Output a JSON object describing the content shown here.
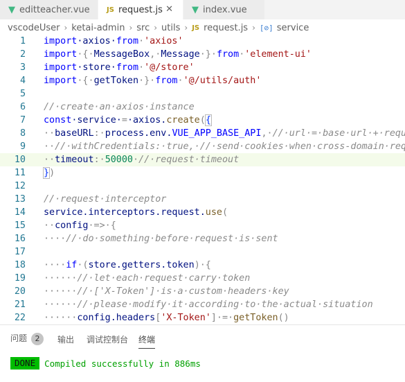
{
  "tabs": [
    {
      "label": "editteacher.vue",
      "icon": "vue-icon",
      "active": false
    },
    {
      "label": "request.js",
      "icon": "js-icon",
      "icon_text": "JS",
      "active": true,
      "close": "✕"
    },
    {
      "label": "index.vue",
      "icon": "vue-icon",
      "active": false
    }
  ],
  "breadcrumb": {
    "items": [
      "vscodeUser",
      "ketai-admin",
      "src",
      "utils"
    ],
    "file_icon": "JS",
    "file": "request.js",
    "symbol_icon": "[⊘]",
    "symbol": "service"
  },
  "editor": {
    "highlighted_line": 10,
    "lines": [
      {
        "n": "1",
        "tokens": [
          [
            "import",
            "kw"
          ],
          [
            "·axios·",
            "id"
          ],
          [
            "from",
            "kw"
          ],
          [
            "·",
            "ws"
          ],
          [
            "'axios'",
            "str"
          ]
        ]
      },
      {
        "n": "2",
        "tokens": [
          [
            "import",
            "kw"
          ],
          [
            "·{·",
            "ws"
          ],
          [
            "MessageBox",
            "id"
          ],
          [
            ",·",
            "ws"
          ],
          [
            "Message",
            "id"
          ],
          [
            "·}·",
            "ws"
          ],
          [
            "from",
            "kw"
          ],
          [
            "·",
            "ws"
          ],
          [
            "'element-ui'",
            "str"
          ]
        ]
      },
      {
        "n": "3",
        "tokens": [
          [
            "import",
            "kw"
          ],
          [
            "·store·",
            "id"
          ],
          [
            "from",
            "kw"
          ],
          [
            "·",
            "ws"
          ],
          [
            "'@/store'",
            "str"
          ]
        ]
      },
      {
        "n": "4",
        "tokens": [
          [
            "import",
            "kw"
          ],
          [
            "·{·",
            "ws"
          ],
          [
            "getToken",
            "id"
          ],
          [
            "·}·",
            "ws"
          ],
          [
            "from",
            "kw"
          ],
          [
            "·",
            "ws"
          ],
          [
            "'@/utils/auth'",
            "str"
          ]
        ]
      },
      {
        "n": "5",
        "tokens": []
      },
      {
        "n": "6",
        "tokens": [
          [
            "//·create·an·axios·instance",
            "cm"
          ]
        ]
      },
      {
        "n": "7",
        "tokens": [
          [
            "const",
            "kw"
          ],
          [
            "·service·",
            "id"
          ],
          [
            "=",
            "ws"
          ],
          [
            "·axios.",
            "id"
          ],
          [
            "create",
            "fn"
          ],
          [
            "(",
            "ws"
          ],
          [
            "{",
            "br"
          ]
        ]
      },
      {
        "n": "8",
        "tokens": [
          [
            "··",
            "ws"
          ],
          [
            "baseURL",
            "id"
          ],
          [
            ":·",
            "ws"
          ],
          [
            "process.env.",
            "id"
          ],
          [
            "VUE_APP_BASE_API",
            "kw"
          ],
          [
            ",·",
            "ws"
          ],
          [
            "//·url·=·base·url·+·request·url",
            "cm"
          ]
        ]
      },
      {
        "n": "9",
        "tokens": [
          [
            "··",
            "ws"
          ],
          [
            "//·withCredentials:·true,·//·send·cookies·when·cross-domain·requests",
            "cm"
          ]
        ]
      },
      {
        "n": "10",
        "tokens": [
          [
            "··",
            "ws"
          ],
          [
            "timeout",
            "id"
          ],
          [
            ":·",
            "ws"
          ],
          [
            "50000",
            "num"
          ],
          [
            "·",
            "ws"
          ],
          [
            "//·request·timeout",
            "cm"
          ]
        ]
      },
      {
        "n": "11",
        "tokens": [
          [
            "}",
            "br"
          ],
          [
            ")",
            "ws"
          ]
        ]
      },
      {
        "n": "12",
        "tokens": []
      },
      {
        "n": "13",
        "tokens": [
          [
            "//·request·interceptor",
            "cm"
          ]
        ]
      },
      {
        "n": "14",
        "tokens": [
          [
            "service.interceptors.request.",
            "id"
          ],
          [
            "use",
            "fn"
          ],
          [
            "(",
            "ws"
          ]
        ]
      },
      {
        "n": "15",
        "tokens": [
          [
            "··",
            "ws"
          ],
          [
            "config",
            "id"
          ],
          [
            "·=>·{",
            "ws"
          ]
        ]
      },
      {
        "n": "16",
        "tokens": [
          [
            "····",
            "ws"
          ],
          [
            "//·do·something·before·request·is·sent",
            "cm"
          ]
        ]
      },
      {
        "n": "17",
        "tokens": []
      },
      {
        "n": "18",
        "tokens": [
          [
            "····",
            "ws"
          ],
          [
            "if",
            "kw"
          ],
          [
            "·(",
            "ws"
          ],
          [
            "store.getters.token",
            "id"
          ],
          [
            ")·{",
            "ws"
          ]
        ]
      },
      {
        "n": "19",
        "tokens": [
          [
            "······",
            "ws"
          ],
          [
            "//·let·each·request·carry·token",
            "cm"
          ]
        ]
      },
      {
        "n": "20",
        "tokens": [
          [
            "······",
            "ws"
          ],
          [
            "//·['X-Token']·is·a·custom·headers·key",
            "cm"
          ]
        ]
      },
      {
        "n": "21",
        "tokens": [
          [
            "······",
            "ws"
          ],
          [
            "//·please·modify·it·according·to·the·actual·situation",
            "cm"
          ]
        ]
      },
      {
        "n": "22",
        "tokens": [
          [
            "······",
            "ws"
          ],
          [
            "config.headers",
            "id"
          ],
          [
            "[",
            "ws"
          ],
          [
            "'X-Token'",
            "str"
          ],
          [
            "]·=·",
            "ws"
          ],
          [
            "getToken",
            "fn"
          ],
          [
            "()",
            "ws"
          ]
        ]
      }
    ]
  },
  "panel": {
    "tabs": [
      {
        "label": "问题",
        "badge": "2",
        "active": false
      },
      {
        "label": "输出",
        "active": false
      },
      {
        "label": "调试控制台",
        "active": false
      },
      {
        "label": "终端",
        "active": true
      }
    ],
    "terminal": {
      "status": "DONE",
      "message": "Compiled successfully in 886ms"
    }
  },
  "colors": {
    "keyword": "#0000ff",
    "identifier": "#001080",
    "string": "#a31515",
    "comment": "#8a8a8a",
    "function": "#795e26",
    "number": "#098658",
    "whitespace": "#888888",
    "bracket": "#0431fa",
    "line_number": "#237893",
    "highlight": "#f4fbea",
    "done_badge": "#00bc00"
  }
}
